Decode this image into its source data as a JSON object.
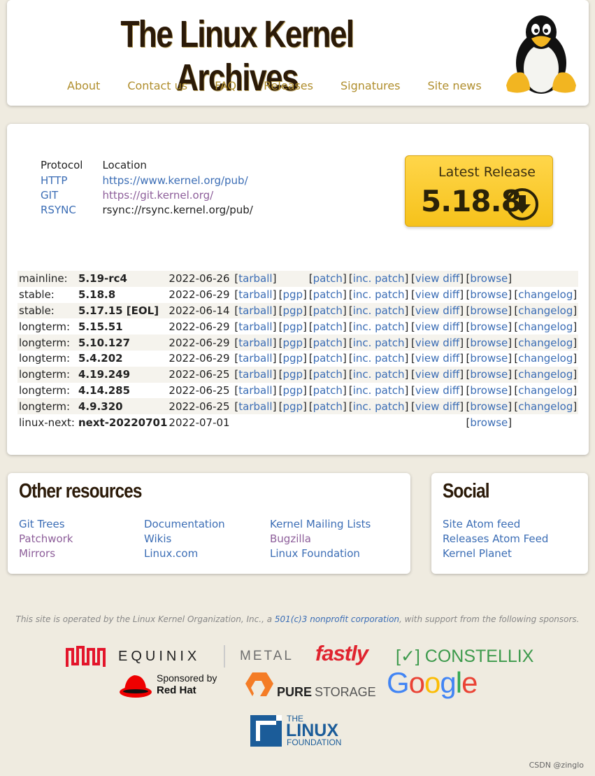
{
  "header": {
    "site_title": "The Linux Kernel Archives",
    "nav": [
      "About",
      "Contact us",
      "FAQ",
      "Releases",
      "Signatures",
      "Site news"
    ]
  },
  "protocols": {
    "headers": [
      "Protocol",
      "Location"
    ],
    "rows": [
      {
        "protocol": "HTTP",
        "location": "https://www.kernel.org/pub/"
      },
      {
        "protocol": "GIT",
        "location": "https://git.kernel.org/"
      },
      {
        "protocol": "RSYNC",
        "location": "rsync://rsync.kernel.org/pub/"
      }
    ]
  },
  "latest_release": {
    "label": "Latest Release",
    "version": "5.18.8"
  },
  "releases": [
    {
      "kind": "mainline:",
      "version": "5.19-rc4",
      "date": "2022-06-26",
      "links": [
        "tarball",
        "",
        "patch",
        "inc. patch",
        "view diff",
        "browse",
        ""
      ]
    },
    {
      "kind": "stable:",
      "version": "5.18.8",
      "date": "2022-06-29",
      "links": [
        "tarball",
        "pgp",
        "patch",
        "inc. patch",
        "view diff",
        "browse",
        "changelog"
      ]
    },
    {
      "kind": "stable:",
      "version": "5.17.15 [EOL]",
      "date": "2022-06-14",
      "links": [
        "tarball",
        "pgp",
        "patch",
        "inc. patch",
        "view diff",
        "browse",
        "changelog"
      ]
    },
    {
      "kind": "longterm:",
      "version": "5.15.51",
      "date": "2022-06-29",
      "links": [
        "tarball",
        "pgp",
        "patch",
        "inc. patch",
        "view diff",
        "browse",
        "changelog"
      ]
    },
    {
      "kind": "longterm:",
      "version": "5.10.127",
      "date": "2022-06-29",
      "links": [
        "tarball",
        "pgp",
        "patch",
        "inc. patch",
        "view diff",
        "browse",
        "changelog"
      ]
    },
    {
      "kind": "longterm:",
      "version": "5.4.202",
      "date": "2022-06-29",
      "links": [
        "tarball",
        "pgp",
        "patch",
        "inc. patch",
        "view diff",
        "browse",
        "changelog"
      ]
    },
    {
      "kind": "longterm:",
      "version": "4.19.249",
      "date": "2022-06-25",
      "links": [
        "tarball",
        "pgp",
        "patch",
        "inc. patch",
        "view diff",
        "browse",
        "changelog"
      ]
    },
    {
      "kind": "longterm:",
      "version": "4.14.285",
      "date": "2022-06-25",
      "links": [
        "tarball",
        "pgp",
        "patch",
        "inc. patch",
        "view diff",
        "browse",
        "changelog"
      ]
    },
    {
      "kind": "longterm:",
      "version": "4.9.320",
      "date": "2022-06-25",
      "links": [
        "tarball",
        "pgp",
        "patch",
        "inc. patch",
        "view diff",
        "browse",
        "changelog"
      ]
    },
    {
      "kind": "linux-next:",
      "version": "next-20220701",
      "date": "2022-07-01",
      "links": [
        "",
        "",
        "",
        "",
        "",
        "browse",
        ""
      ]
    }
  ],
  "resources": {
    "title": "Other resources",
    "columns": [
      [
        "Git Trees",
        "Patchwork",
        "Mirrors"
      ],
      [
        "Documentation",
        "Wikis",
        "Linux.com"
      ],
      [
        "Kernel Mailing Lists",
        "Bugzilla",
        "Linux Foundation"
      ]
    ]
  },
  "social": {
    "title": "Social",
    "links": [
      "Site Atom feed",
      "Releases Atom Feed",
      "Kernel Planet"
    ]
  },
  "footer": {
    "text_before": "This site is operated by the Linux Kernel Organization, Inc., a ",
    "link": "501(c)3 nonprofit corporation",
    "text_after": ", with support from the following sponsors."
  },
  "sponsors": {
    "equinix": "EQUINIX",
    "metal": "METAL",
    "fastly": "fastly",
    "constellix_mark": "[✓]",
    "constellix": "CONSTELLIX",
    "redhat_line1": "Sponsored by",
    "redhat_line2": "Red Hat",
    "pure_a": "PURE",
    "pure_b": "STORAGE",
    "google": [
      "G",
      "o",
      "o",
      "g",
      "l",
      "e"
    ],
    "lf_line1": "THE",
    "lf_line2": "LINUX",
    "lf_line3": "FOUNDATION"
  },
  "watermark": "CSDN @zinglo",
  "colors": {
    "background": "#efebe0",
    "link": "#3b6db5",
    "visited": "#8d5e9a",
    "nav": "#b08e2d",
    "latest_button": "#f6c21b"
  }
}
